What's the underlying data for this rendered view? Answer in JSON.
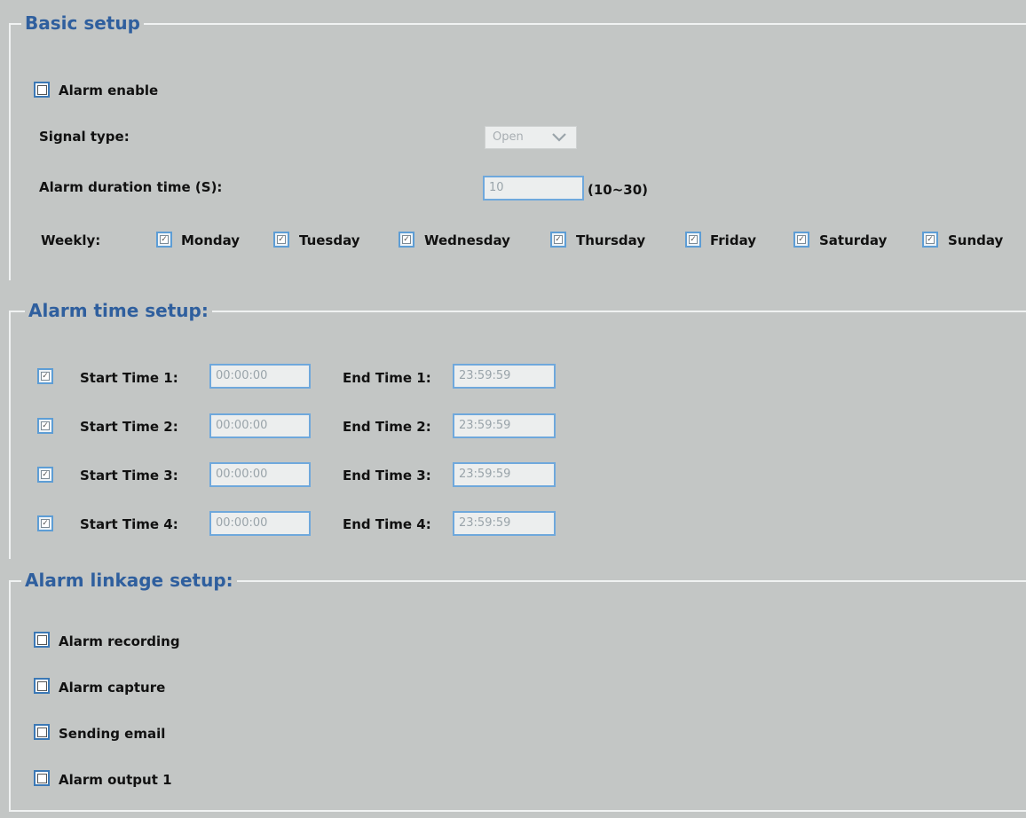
{
  "basic_setup": {
    "title": "Basic setup",
    "alarm_enable": {
      "label": "Alarm enable",
      "checked": false
    },
    "signal_type": {
      "label": "Signal type:",
      "value": "Open"
    },
    "alarm_duration": {
      "label": "Alarm duration time (S):",
      "value": "10",
      "range": "(10~30)"
    },
    "weekly": {
      "label": "Weekly:",
      "days": [
        "Monday",
        "Tuesday",
        "Wednesday",
        "Thursday",
        "Friday",
        "Saturday",
        "Sunday"
      ]
    }
  },
  "alarm_time_setup": {
    "title": "Alarm time setup:",
    "rows": [
      {
        "start_label": "Start Time 1:",
        "start_value": "00:00:00",
        "end_label": "End Time 1:",
        "end_value": "23:59:59"
      },
      {
        "start_label": "Start Time 2:",
        "start_value": "00:00:00",
        "end_label": "End Time 2:",
        "end_value": "23:59:59"
      },
      {
        "start_label": "Start Time 3:",
        "start_value": "00:00:00",
        "end_label": "End Time 3:",
        "end_value": "23:59:59"
      },
      {
        "start_label": "Start Time 4:",
        "start_value": "00:00:00",
        "end_label": "End Time 4:",
        "end_value": "23:59:59"
      }
    ]
  },
  "alarm_linkage_setup": {
    "title": "Alarm linkage setup:",
    "items": [
      "Alarm recording",
      "Alarm capture",
      "Sending email",
      "Alarm output 1"
    ]
  },
  "colors": {
    "background": "#c3c6c5",
    "title": "#2f5f9e",
    "checkbox_border": "#5d9dd5"
  },
  "icons": {
    "checkbox_checked": "check-mark",
    "select_arrow": "chevron-down-icon"
  }
}
